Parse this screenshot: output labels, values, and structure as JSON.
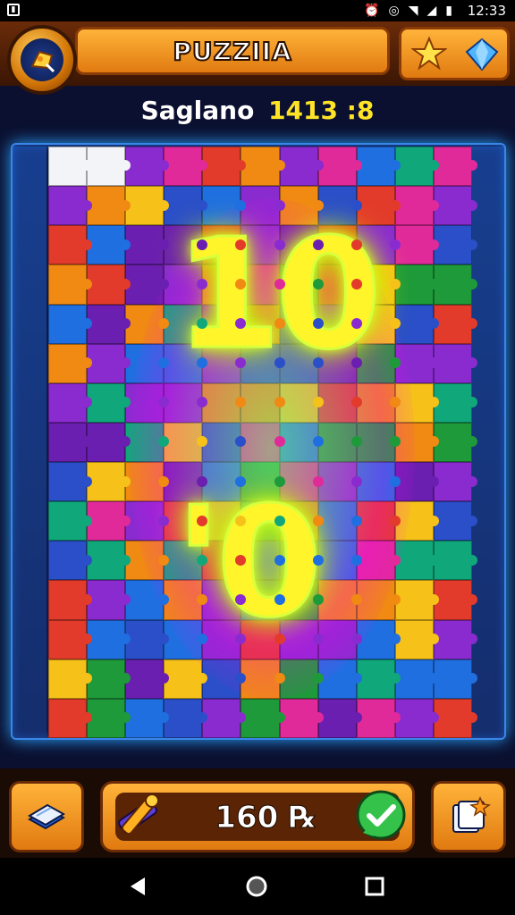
{
  "status_bar": {
    "time": "12:33",
    "icons": [
      "notification-icon",
      "alarm-icon",
      "vibrate-icon",
      "wifi-icon",
      "signal-icon",
      "battery-icon"
    ]
  },
  "header": {
    "title": "PUZZIIA",
    "logo_icon": "puzzle-piece-icon",
    "star_icon": "star-icon",
    "gem_icon": "gem-icon"
  },
  "score": {
    "label": "Saglano",
    "value": "1413 :8"
  },
  "board": {
    "overlay_top": "10",
    "overlay_bottom": "'0",
    "piece_colors": [
      "#1f6fe0",
      "#e23b2b",
      "#f08a12",
      "#1e9a3a",
      "#8a2bd0",
      "#e02a9a",
      "#2a4fc8",
      "#f6c21a",
      "#10a87a",
      "#6b1fb0"
    ],
    "blank_pieces": 2
  },
  "bottom": {
    "coins": "160 ℞",
    "left_button_icon": "book-icon",
    "right_button_icon": "hint-card-icon",
    "tool_icon": "hammer-icon",
    "confirm_icon": "check-icon"
  },
  "colors": {
    "accent_orange": "#e07a10",
    "score_yellow": "#ffe326",
    "glow_yellow": "#fff52a"
  }
}
